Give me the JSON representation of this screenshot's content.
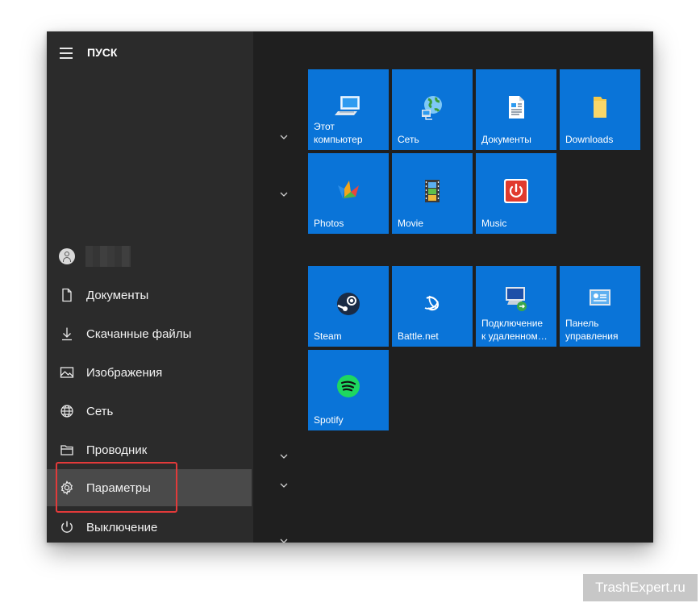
{
  "start": {
    "title": "ПУСК"
  },
  "nav_items": [
    {
      "label": "Документы",
      "icon": "document-icon"
    },
    {
      "label": "Скачанные файлы",
      "icon": "download-icon"
    },
    {
      "label": "Изображения",
      "icon": "image-icon"
    },
    {
      "label": "Сеть",
      "icon": "globe-icon"
    },
    {
      "label": "Проводник",
      "icon": "explorer-icon"
    },
    {
      "label": "Параметры",
      "icon": "gear-icon"
    },
    {
      "label": "Выключение",
      "icon": "power-icon"
    }
  ],
  "tiles": [
    {
      "label": "Этот\nкомпьютер",
      "icon": "computer-icon"
    },
    {
      "label": "Сеть",
      "icon": "network-globe-icon"
    },
    {
      "label": "Документы",
      "icon": "document-icon"
    },
    {
      "label": "Downloads",
      "icon": "folder-icon"
    },
    {
      "label": "Photos",
      "icon": "photos-icon"
    },
    {
      "label": "Movie",
      "icon": "film-icon"
    },
    {
      "label": "Music",
      "icon": "music-power-icon"
    },
    {
      "label": "Steam",
      "icon": "steam-icon"
    },
    {
      "label": "Battle.net",
      "icon": "battlenet-icon"
    },
    {
      "label": "Подключение\nк удаленном…",
      "icon": "remote-desktop-icon"
    },
    {
      "label": "Панель\nуправления",
      "icon": "control-panel-icon"
    },
    {
      "label": "Spotify",
      "icon": "spotify-icon"
    }
  ],
  "colors": {
    "tile": "#0a74d8",
    "highlight": "#e23a3a",
    "pane_background": "#1f1f1f",
    "left_pane": "#2b2b2b"
  },
  "watermark": "TrashExpert.ru"
}
